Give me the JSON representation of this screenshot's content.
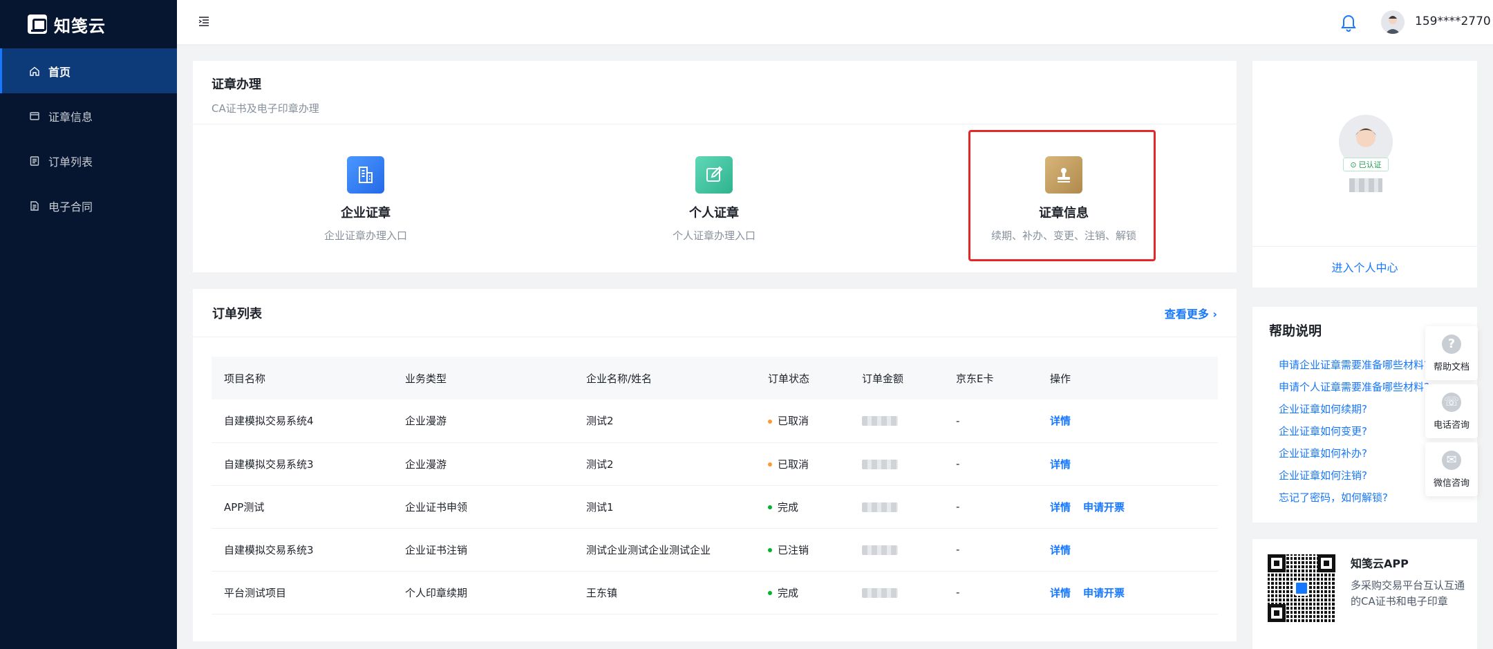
{
  "brand": {
    "name": "知笺云"
  },
  "sidebar": {
    "items": [
      {
        "label": "首页",
        "icon": "home-icon",
        "active": true
      },
      {
        "label": "证章信息",
        "icon": "cert-icon",
        "active": false
      },
      {
        "label": "订单列表",
        "icon": "list-icon",
        "active": false
      },
      {
        "label": "电子合同",
        "icon": "contract-icon",
        "active": false
      }
    ]
  },
  "header": {
    "user": "159****2770"
  },
  "certs": {
    "title": "证章办理",
    "subtitle": "CA证书及电子印章办理",
    "tiles": [
      {
        "title": "企业证章",
        "sub": "企业证章办理入口",
        "color": "#2f7cf6"
      },
      {
        "title": "个人证章",
        "sub": "个人证章办理入口",
        "color": "#3ec6a1"
      },
      {
        "title": "证章信息",
        "sub": "续期、补办、变更、注销、解锁",
        "color": "#c9a063"
      }
    ]
  },
  "orders": {
    "title": "订单列表",
    "more": "查看更多",
    "columns": [
      "项目名称",
      "业务类型",
      "企业名称/姓名",
      "订单状态",
      "订单金额",
      "京东E卡",
      "操作"
    ],
    "rows": [
      {
        "name": "自建模拟交易系统4",
        "type": "企业漫游",
        "org": "测试2",
        "status": "已取消",
        "status_color": "#ff9a2e",
        "ecard": "-",
        "actions": [
          "详情"
        ]
      },
      {
        "name": "自建模拟交易系统3",
        "type": "企业漫游",
        "org": "测试2",
        "status": "已取消",
        "status_color": "#ff9a2e",
        "ecard": "-",
        "actions": [
          "详情"
        ]
      },
      {
        "name": "APP测试",
        "type": "企业证书申领",
        "org": "测试1",
        "status": "完成",
        "status_color": "#00b42a",
        "ecard": "-",
        "actions": [
          "详情",
          "申请开票"
        ]
      },
      {
        "name": "自建模拟交易系统3",
        "type": "企业证书注销",
        "org": "测试企业测试企业测试企业",
        "status": "已注销",
        "status_color": "#00b42a",
        "ecard": "-",
        "actions": [
          "详情"
        ]
      },
      {
        "name": "平台测试项目",
        "type": "个人印章续期",
        "org": "王东镇",
        "status": "完成",
        "status_color": "#00b42a",
        "ecard": "-",
        "actions": [
          "详情",
          "申请开票"
        ]
      }
    ]
  },
  "profile": {
    "badge": "已认证",
    "link": "进入个人中心"
  },
  "help": {
    "title": "帮助说明",
    "items": [
      "申请企业证章需要准备哪些材料?",
      "申请个人证章需要准备哪些材料?",
      "企业证章如何续期?",
      "企业证章如何变更?",
      "企业证章如何补办?",
      "企业证章如何注销?",
      "忘记了密码，如何解锁?"
    ]
  },
  "app": {
    "title": "知笺云APP",
    "desc": "多采购交易平台互认互通的CA证书和电子印章"
  },
  "float": [
    {
      "label": "帮助文档",
      "icon": "question-icon",
      "glyph": "?"
    },
    {
      "label": "电话咨询",
      "icon": "phone-icon",
      "glyph": "☏"
    },
    {
      "label": "微信咨询",
      "icon": "wechat-icon",
      "glyph": "✉"
    }
  ]
}
